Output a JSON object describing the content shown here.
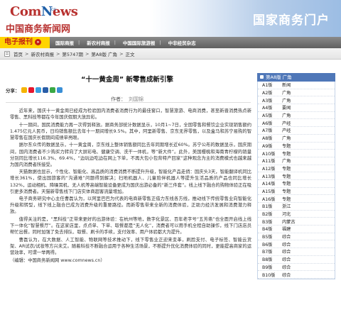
{
  "header": {
    "logo_main_a": "Com",
    "logo_main_n": "N",
    "logo_main_b": "ews",
    "logo_domain": ".cn",
    "logo_cn": "中国商务新闻网",
    "portal_title": "国家商务门户"
  },
  "nav": {
    "brand": "电子报刊",
    "brand_arrow": "»",
    "links": [
      "国际商报",
      "新农村商报",
      "中国国际旅游报",
      "中非经贸杂志"
    ],
    "separator": "|"
  },
  "breadcrumb": {
    "items": [
      "首页",
      "新农村商报",
      "第5747期",
      "第A8版 广角",
      "正文"
    ],
    "separator": ">"
  },
  "article": {
    "title": "“十一黄金周” 新零售成新引擎",
    "share_label": "分享：",
    "share_icons": [
      {
        "name": "qzone-icon",
        "color": "#f5b400"
      },
      {
        "name": "weibo-icon",
        "color": "#e6162d"
      },
      {
        "name": "tencent-weibo-icon",
        "color": "#3aa0e0"
      },
      {
        "name": "renren-icon",
        "color": "#2a5ea8"
      },
      {
        "name": "douban-icon",
        "color": "#3aa845"
      },
      {
        "name": "more-share-icon",
        "color": "#3a8fd6"
      }
    ],
    "author_label": "作者：",
    "author_name": "刘国锦",
    "paragraphs": [
      "近年来，国庆十一黄金周已经成为检验国内消费者消费行为的最佳窗口，智慧旅游、电商消费，甚至新晋消费热点新零售、黑科技等都在今年国庆假期大放异彩。",
      "十一期间，国民消费能力再一次得到释放。据商务部统计数据显示，10月1~7日，全国零售和餐饮企业实现销售额约1.475亿元人民币，日均销售额比去年十一期间增长9.5%。其中，阿里新零售、京东无界零售，以及盒马和苏宁易购的智慧零售在国庆长假期间成绩单亮眼。",
      "据尔东众传的数据显示，十一黄金周，京东线上整体销售额同比去年同期增长近60%。苏宁公布的数据显示，国庆期间，国内消费者不少购买力转向了大屏彩电、健康空调、洗干一体机，等“新大件”。此外，美国樱桃和海南青柠檬的销量分别同比增长116.3%、69.4%，“边玩边吃边在网上下单，不再大包小包背特产回家”这种观念为主的消费模式也越来越为国内消费者所接受。",
      "天猫数据也显示，个性化、智能化、高品质的消费消费不断提升升级，智能化产品走俏：国庆头3天，智能翻译机同比增长361%，使出国旅客的“沟通难”问题得到解决；扫地机器人、儿童陪伴机器人等提升生活品质的产品也同比增长132%，运动相机、降噪耳机、无人机等高端智能设备更成为国庆出游必备的“新三件套”。线上线下融合的购物体验正在吸引更多消费者。天猫新零售线下门店实体商超客流量增加。",
      "电子商务研究中心主任曹磊认为，以阿里巴巴为代表的电商新零售正借力东线各方线，推动线下传统零售业向智能化升级和转型，线下线上融合已成为消费升级的重要路径。而新零售带来全新的消费体验，正助力经济发展和消费潜力释放。",
      "值得关注的是，“黑科技”正带来更好的出游体验：在杭州等地，数字化景区、百年老字号“五芳斋”也全面开启线上线下一体化“智慧餐厅”。在这家店里，点点单、下单、取餐都是“无人化”，消费者可以用手机全程自助操作，线下门店店员帮忙出餐。同时加强了免去排队、取餐、刷卡的手续，支付效率、用户体验都大为提升。",
      "曹磊认为，在大数据、人工智能、物联网等技术推动下，线下零售业正迎来变革，刷脸支付、电子标签、智能云货架、AR试衣/试妆等方兴未艾。随着科技不断融合运用于各种生活场景，不断提升优化消费体验的同时，更能提高商家的运营效率，可谓一举两得。"
    ],
    "editor": "（编辑：中国商务新闻网 www.comnews.cn）"
  },
  "sidebar": {
    "header": "第A8版 广角",
    "items": [
      {
        "ed": "A1版",
        "name": "新闻"
      },
      {
        "ed": "A2版",
        "name": "广角"
      },
      {
        "ed": "A3版",
        "name": "广角"
      },
      {
        "ed": "A4版",
        "name": "要闻"
      },
      {
        "ed": "A5版",
        "name": "广角"
      },
      {
        "ed": "A6版",
        "name": "产经"
      },
      {
        "ed": "A7版",
        "name": "产经"
      },
      {
        "ed": "A8版",
        "name": "广角"
      },
      {
        "ed": "A9版",
        "name": "专题"
      },
      {
        "ed": "A10版",
        "name": "专题"
      },
      {
        "ed": "A11版",
        "name": "广角"
      },
      {
        "ed": "A12版",
        "name": "专题"
      },
      {
        "ed": "A13版",
        "name": "专题"
      },
      {
        "ed": "A14版",
        "name": "专题"
      },
      {
        "ed": "A15版",
        "name": "专题"
      },
      {
        "ed": "A16版",
        "name": "专题"
      },
      {
        "ed": "B1版",
        "name": "浙江"
      },
      {
        "ed": "B2版",
        "name": "河北"
      },
      {
        "ed": "B3版",
        "name": "内蒙古"
      },
      {
        "ed": "B4版",
        "name": "福建"
      },
      {
        "ed": "B5版",
        "name": "综合"
      },
      {
        "ed": "B6版",
        "name": "综合"
      },
      {
        "ed": "B7版",
        "name": "综合"
      },
      {
        "ed": "B8版",
        "name": "综合"
      },
      {
        "ed": "B9版",
        "name": "综合"
      },
      {
        "ed": "B10版",
        "name": "综合"
      }
    ]
  }
}
